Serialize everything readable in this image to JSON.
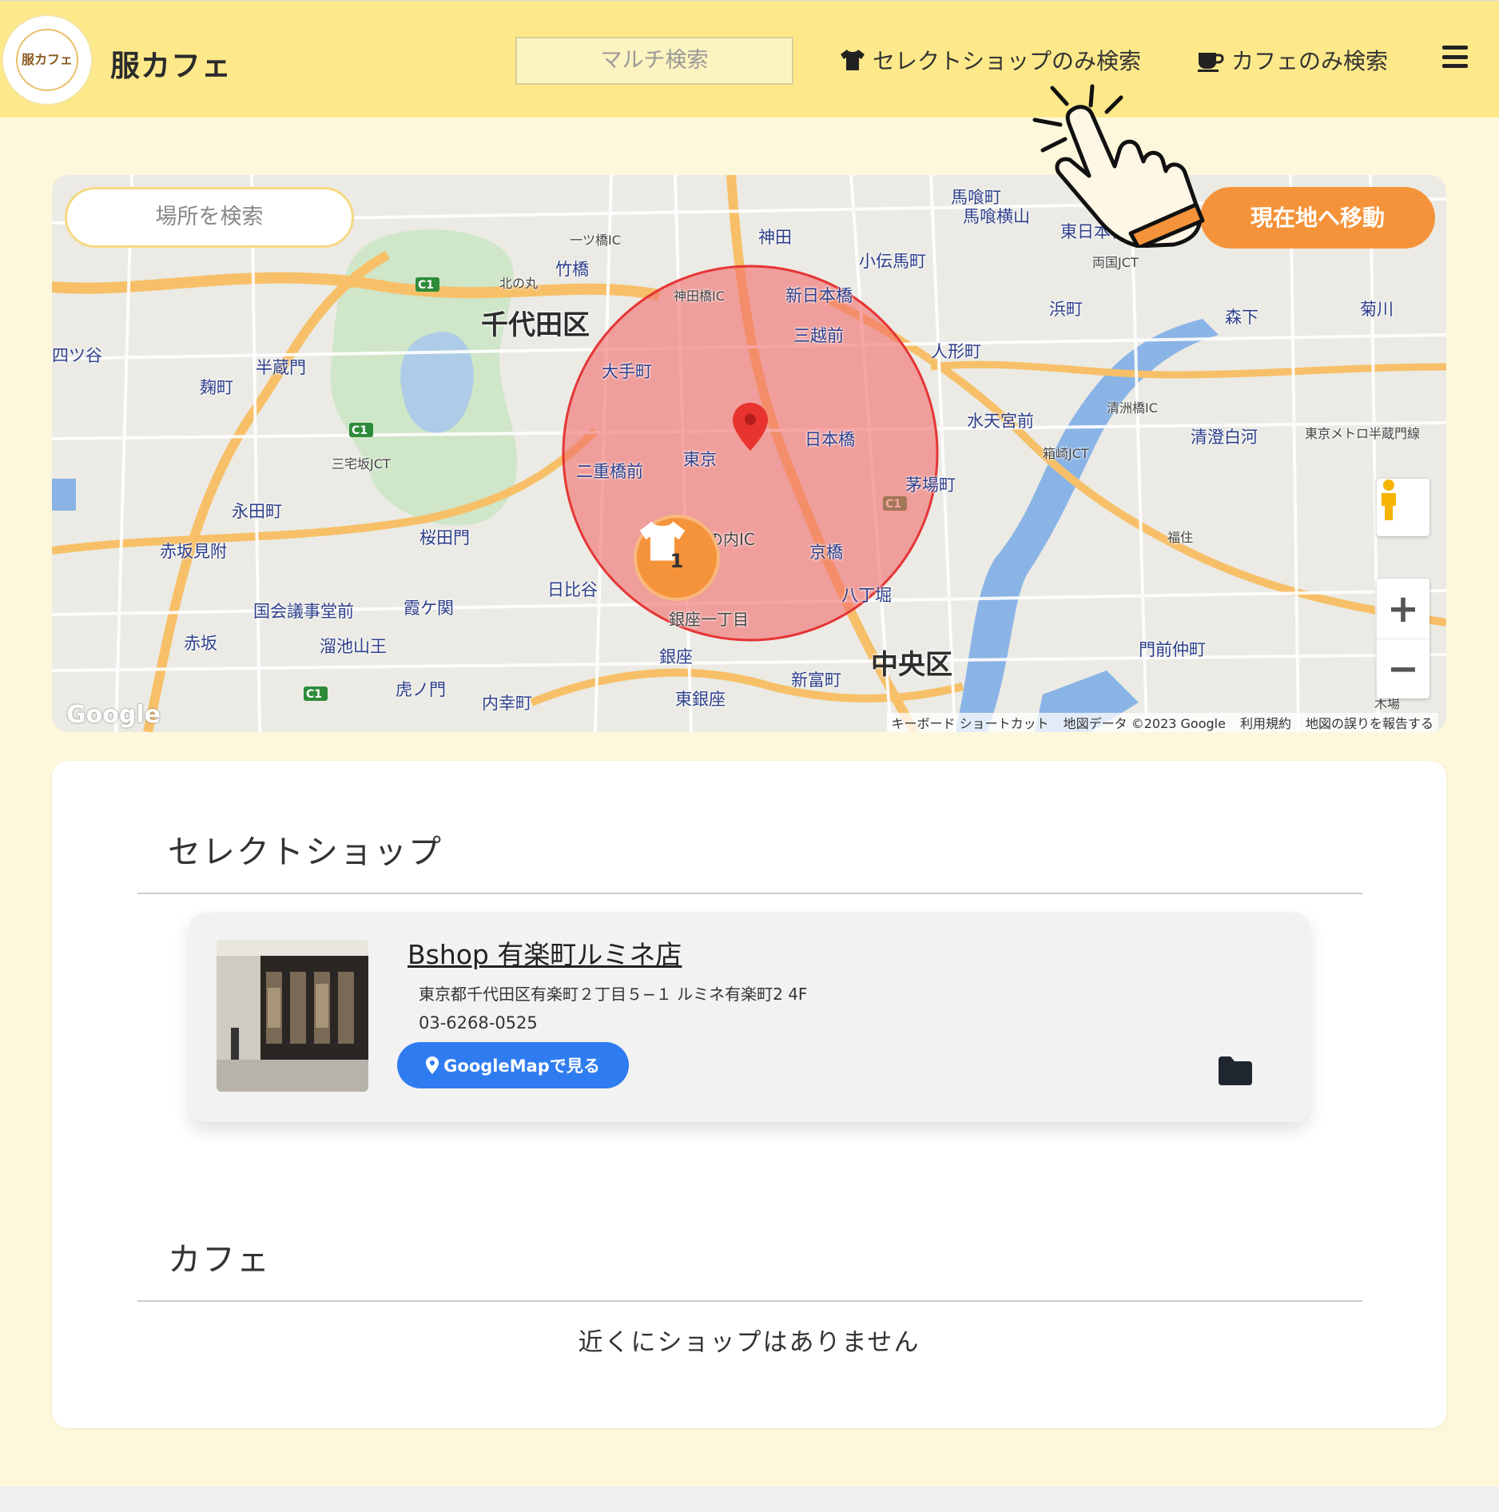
{
  "header": {
    "logo_text": "服カフェ",
    "brand": "服カフェ",
    "multi_search_placeholder": "マルチ検索",
    "nav_select_label": "セレクトショップのみ検索",
    "nav_cafe_label": "カフェのみ検索"
  },
  "map": {
    "place_search_placeholder": "場所を検索",
    "locate_button": "現在地へ移動",
    "cluster_count": "1",
    "zoom_in": "+",
    "zoom_out": "−",
    "google_logo": "Google",
    "attribution": [
      "キーボード ショートカット",
      "地図データ ©2023 Google",
      "利用規約",
      "地図の誤りを報告する"
    ],
    "labels": {
      "chiyoda": "千代田区",
      "chuo": "中央区",
      "tokyo": "東京",
      "kanda": "神田",
      "otemachi": "大手町",
      "nihonbashi": "日本橋",
      "mitsukoshimae": "三越前",
      "kyobashi": "京橋",
      "ginza": "銀座",
      "hibiya": "日比谷",
      "yurakucho_ic": "の内IC",
      "ginza1": "銀座一丁目",
      "nijubashimae": "二重橋前",
      "sakuradamon": "桜田門",
      "kasumigaseki": "霞ケ関",
      "nagatacho": "永田町",
      "kojimachi": "麹町",
      "hanzomon": "半蔵門",
      "yotsuya": "四ツ谷",
      "akasakamitsuke": "赤坂見附",
      "akasaka": "赤坂",
      "toranomon": "虎ノ門",
      "tameike": "溜池山王",
      "kokkai": "国会議事堂前",
      "uchisaiwaicho": "内幸町",
      "higashiginza": "東銀座",
      "shintomicho": "新富町",
      "hatchobori": "八丁堀",
      "kayabacho": "茅場町",
      "suitengumae": "水天宮前",
      "ningyocho": "人形町",
      "kodenmacho": "小伝馬町",
      "bakurocho": "馬喰町",
      "bakuroyokoyama": "馬喰横山",
      "higashinihonbashi": "東日本橋",
      "hamacho": "浜町",
      "morishita": "森下",
      "kikukawa": "菊川",
      "kiyosumi": "清澄白河",
      "monzen": "門前仲町",
      "shinnihonbashi": "新日本橋",
      "takebashi": "竹橋",
      "hitotsubashi_ic": "一ツ橋IC",
      "kandabashi_ic": "神田橋IC",
      "kitanomaru": "北の丸",
      "miyakezaka": "三宅坂JCT",
      "ryogoku": "両国JCT",
      "hakozaki": "箱崎JCT",
      "kiyosubashi": "清洲橋IC",
      "fukagawa": "福住",
      "hanzomon_line": "東京メトロ半蔵門線",
      "kiba": "木場"
    }
  },
  "select_section": {
    "title": "セレクトショップ",
    "shops": [
      {
        "name": "Bshop 有楽町ルミネ店",
        "address": "東京都千代田区有楽町２丁目５−１ ルミネ有楽町2 4F",
        "tel": "03-6268-0525",
        "map_button": "GoogleMapで見る",
        "folder_icon": "folder-icon"
      }
    ]
  },
  "cafe_section": {
    "title": "カフェ",
    "empty_message": "近くにショップはありません"
  },
  "colors": {
    "header_bg": "#fde98a",
    "page_bg": "#fdf8dc",
    "accent_orange": "#f5933a",
    "button_blue": "#2f7cf0",
    "radius_fill": "#f26b6b"
  }
}
